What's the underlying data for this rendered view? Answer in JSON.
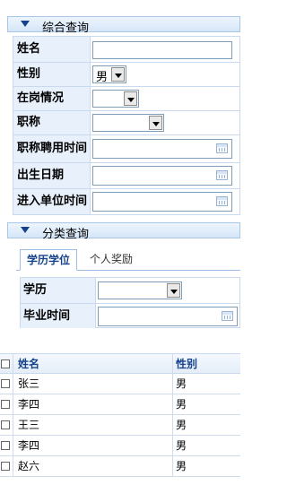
{
  "composite_query": {
    "title": "综合查询",
    "fields": [
      {
        "label": "姓名",
        "type": "text",
        "value": ""
      },
      {
        "label": "性别",
        "type": "select",
        "value": "男"
      },
      {
        "label": "在岗情况",
        "type": "select",
        "value": ""
      },
      {
        "label": "职称",
        "type": "select",
        "value": ""
      },
      {
        "label": "职称聘用时间",
        "type": "date",
        "value": ""
      },
      {
        "label": "出生日期",
        "type": "date",
        "value": ""
      },
      {
        "label": "进入单位时间",
        "type": "date",
        "value": ""
      }
    ]
  },
  "category_query": {
    "title": "分类查询",
    "tabs": [
      {
        "label": "学历学位",
        "active": true
      },
      {
        "label": "个人奖励",
        "active": false
      }
    ],
    "fields": [
      {
        "label": "学历",
        "type": "select",
        "value": ""
      },
      {
        "label": "毕业时间",
        "type": "date",
        "value": ""
      }
    ]
  },
  "table": {
    "columns": [
      "姓名",
      "性别"
    ],
    "rows": [
      [
        "张三",
        "男"
      ],
      [
        "李四",
        "男"
      ],
      [
        "王三",
        "男"
      ],
      [
        "李四",
        "男"
      ],
      [
        "赵六",
        "男"
      ]
    ]
  },
  "colors": {
    "header_text": "#15428b",
    "label_bg": "#e7f0fb",
    "border": "#c9daef"
  }
}
